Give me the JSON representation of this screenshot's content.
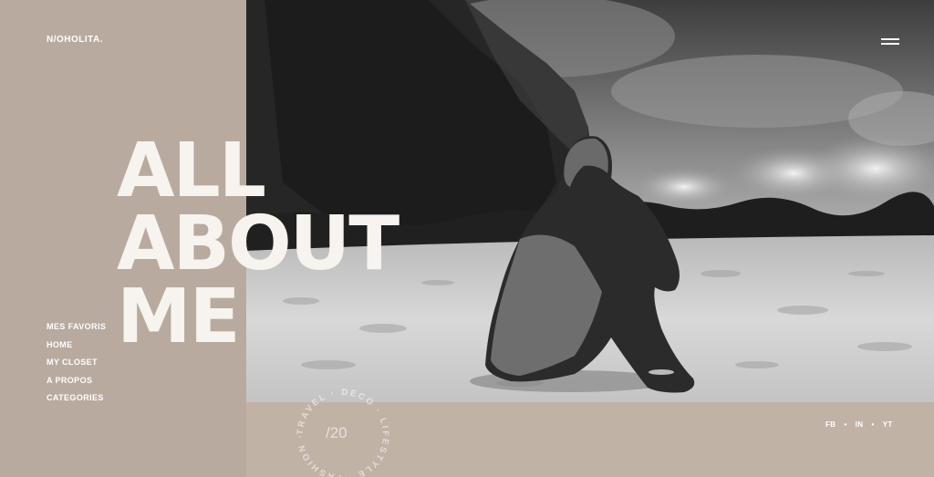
{
  "brand": {
    "logo": "N/OHOLITA."
  },
  "hero": {
    "line1": "ALL",
    "line2": "ABOUT",
    "line3": "ME"
  },
  "nav": {
    "items": [
      "MES FAVORIS",
      "HOME",
      "MY CLOSET",
      "A PROPOS",
      "CATEGORIES"
    ]
  },
  "badge": {
    "number": "/20",
    "ring_text": "TRAVEL · DECO · LIFESTYLE · FASHION · "
  },
  "social": {
    "items": [
      "FB",
      "IN",
      "YT"
    ],
    "separator": "•"
  },
  "colors": {
    "background": "#c1b2a6",
    "left_column": "#b9aaa0",
    "text": "#ffffff"
  },
  "icons": {
    "menu": "hamburger-icon"
  }
}
